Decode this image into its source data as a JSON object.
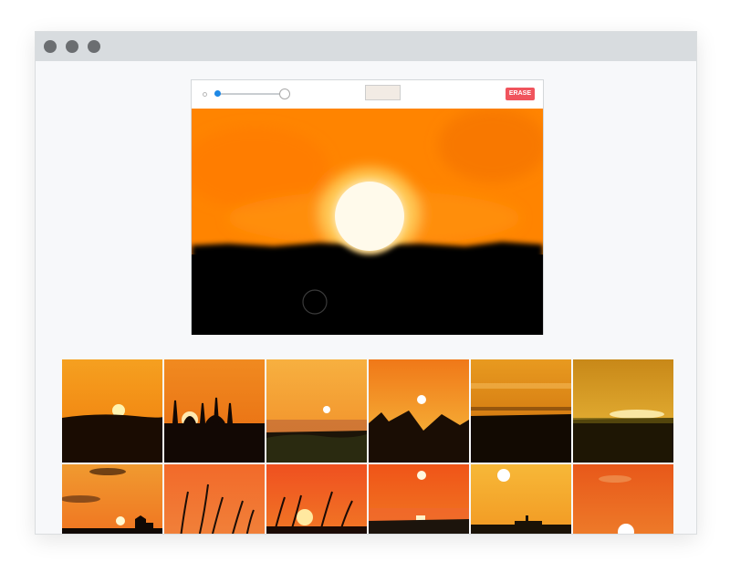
{
  "window": {
    "controls": [
      "close-dot",
      "minimize-dot",
      "maximize-dot"
    ]
  },
  "editor": {
    "brush_size_fraction": 0.05,
    "brush_color": "#f2ebe4",
    "erase_label": "ERASE",
    "erase_color": "#f0545d",
    "accent_color": "#1e88e5",
    "canvas_colors": {
      "sky": "#ff8400",
      "sun": "#fffaeb",
      "ground": "#000000"
    }
  },
  "gallery": {
    "thumbnails": [
      {
        "name": "sunset-sun-over-hills",
        "sky": [
          "#f5a020",
          "#f07a0a"
        ],
        "sun": "#fff3b0",
        "scene": "hills"
      },
      {
        "name": "sunset-mosque-silhouette",
        "sky": [
          "#f08a20",
          "#e86a10"
        ],
        "sun": "#ffe9b0",
        "scene": "mosque"
      },
      {
        "name": "sunset-over-sea-haze",
        "sky": [
          "#f7b040",
          "#f08a25"
        ],
        "sun": "#ffffff",
        "scene": "sea"
      },
      {
        "name": "sunset-rock-peaks",
        "sky": [
          "#f07818",
          "#f7c040"
        ],
        "sun": "#ffffff",
        "scene": "peaks"
      },
      {
        "name": "sunset-clouds-horizon",
        "sky": [
          "#e89a20",
          "#c86808"
        ],
        "sun": "#ffd080",
        "scene": "plain"
      },
      {
        "name": "sunset-golden-field",
        "sky": [
          "#c88818",
          "#f0c040"
        ],
        "sun": "#fff6c0",
        "scene": "field"
      },
      {
        "name": "sunset-clouds-town",
        "sky": [
          "#f09a30",
          "#f0641a"
        ],
        "sun": "#fff8d0",
        "scene": "town"
      },
      {
        "name": "sunset-grass-orange",
        "sky": [
          "#f26a2a",
          "#f08a40"
        ],
        "sun": "#ffd0a0",
        "scene": "grass"
      },
      {
        "name": "sunset-grass-sun",
        "sky": [
          "#ef5020",
          "#f28a28"
        ],
        "sun": "#ffe9a0",
        "scene": "grasssun"
      },
      {
        "name": "sunset-sea-reflection",
        "sky": [
          "#f05418",
          "#f08a28"
        ],
        "sun": "#fff8e0",
        "scene": "searef"
      },
      {
        "name": "sunset-lighthouse",
        "sky": [
          "#f7b838",
          "#ef8a18"
        ],
        "sun": "#ffffff",
        "scene": "lighthouse"
      },
      {
        "name": "sunset-big-sun-horizon",
        "sky": [
          "#e8581a",
          "#f08a30"
        ],
        "sun": "#ffffff",
        "scene": "bigsun"
      }
    ]
  }
}
